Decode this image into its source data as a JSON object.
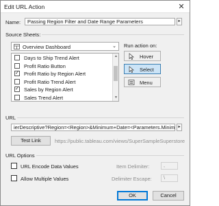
{
  "dialog": {
    "title": "Edit URL Action",
    "close_glyph": "✕"
  },
  "name": {
    "label": "Name:",
    "value": "Passing Region Filter and Date Range Parameters",
    "arrow": "▸"
  },
  "source_sheets": {
    "label": "Source Sheets:",
    "dashboard": "Overview Dashboard",
    "items": [
      {
        "label": "Days to Ship Trend Alert",
        "checked": false
      },
      {
        "label": "Profit Ratio Button",
        "checked": false
      },
      {
        "label": "Profit Ratio by Region Alert",
        "checked": true
      },
      {
        "label": "Profit Ratio Trend Alert",
        "checked": false
      },
      {
        "label": "Sales by Region Alert",
        "checked": true
      },
      {
        "label": "Sales Trend Alert",
        "checked": false
      }
    ]
  },
  "run_action": {
    "label": "Run action on:",
    "options": [
      {
        "label": "Hover",
        "icon": "cursor-icon",
        "selected": false
      },
      {
        "label": "Select",
        "icon": "pointer-icon",
        "selected": true
      },
      {
        "label": "Menu",
        "icon": "menu-icon",
        "selected": false
      }
    ]
  },
  "url": {
    "section_label": "URL",
    "value": "ierDescriptive?Region=<Region>&Minimum+Date=<Parameters.Minimum",
    "arrow": "▸",
    "test_link_label": "Test Link",
    "preview": "https://public.tableau.com/views/SuperSampleSuperstore"
  },
  "url_options": {
    "section_label": "URL Options",
    "encode_label": "URL Encode Data Values",
    "multiple_label": "Allow Multiple Values",
    "item_delimiter_label": "Item Delimiter:",
    "item_delimiter_value": ",",
    "delimiter_escape_label": "Delimiter Escape:",
    "delimiter_escape_value": "\\"
  },
  "footer": {
    "ok_label": "OK",
    "cancel_label": "Cancel"
  },
  "colors": {
    "accent": "#0078d7",
    "selected_bg": "#cce4f7"
  }
}
